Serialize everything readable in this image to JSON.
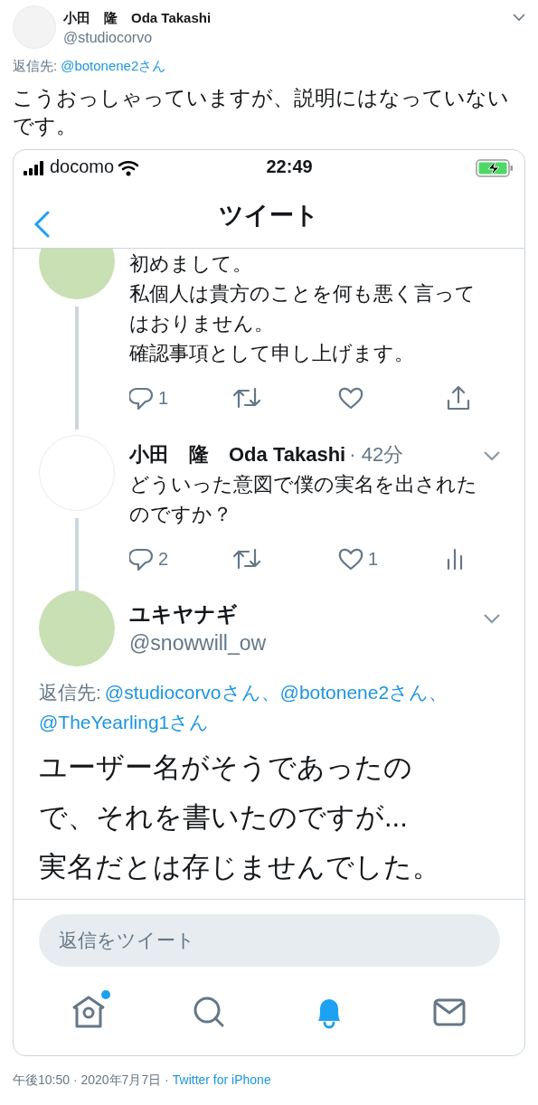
{
  "tweet": {
    "author_name": "小田　隆　Oda Takashi",
    "handle": "@studiocorvo",
    "reply_label": "返信先:",
    "reply_to": "@botonene2さん",
    "text": "こうおっしゃっていますが、説明にはなっていないです。",
    "screenshot": {
      "status_bar": {
        "carrier": "docomo",
        "time": "22:49",
        "charging": true
      },
      "nav": {
        "title": "ツイート"
      },
      "thread": [
        {
          "kind": "cut",
          "lines": [
            "初めまして。",
            "私個人は貴方のことを何も悪く言ってはおりません。",
            "確認事項として申し上げます。"
          ],
          "actions": [
            {
              "kind": "reply",
              "count": "1"
            },
            {
              "kind": "retweet"
            },
            {
              "kind": "like"
            },
            {
              "kind": "share"
            }
          ]
        },
        {
          "kind": "parent",
          "name": "小田　隆　Oda Takashi",
          "time": "· 42分",
          "text": "どういった意図で僕の実名を出されたのですか？",
          "actions": [
            {
              "kind": "reply",
              "count": "2"
            },
            {
              "kind": "retweet"
            },
            {
              "kind": "like",
              "count": "1"
            },
            {
              "kind": "analytics"
            }
          ]
        },
        {
          "kind": "focused",
          "name": "ユキヤナギ",
          "handle": "@snowwill_ow",
          "reply_label": "返信先:",
          "reply_to": [
            "@studiocorvoさん、",
            "@botonene2さん、",
            "@TheYearling1さん"
          ],
          "lines": [
            "ユーザー名がそうであったので、それを書いたのですが...",
            "実名だとは存じませんでした。"
          ]
        }
      ],
      "reply_field": {
        "placeholder": "返信をツイート"
      },
      "tab_bar": [
        {
          "kind": "home",
          "selected": false,
          "badge": true
        },
        {
          "kind": "search",
          "selected": false,
          "badge": false
        },
        {
          "kind": "notifications",
          "selected": true,
          "badge": false
        },
        {
          "kind": "messages",
          "selected": false,
          "badge": false
        }
      ]
    },
    "timestamp": "午後10:50 · 2020年7月7日 ·",
    "source": "Twitter for iPhone"
  }
}
